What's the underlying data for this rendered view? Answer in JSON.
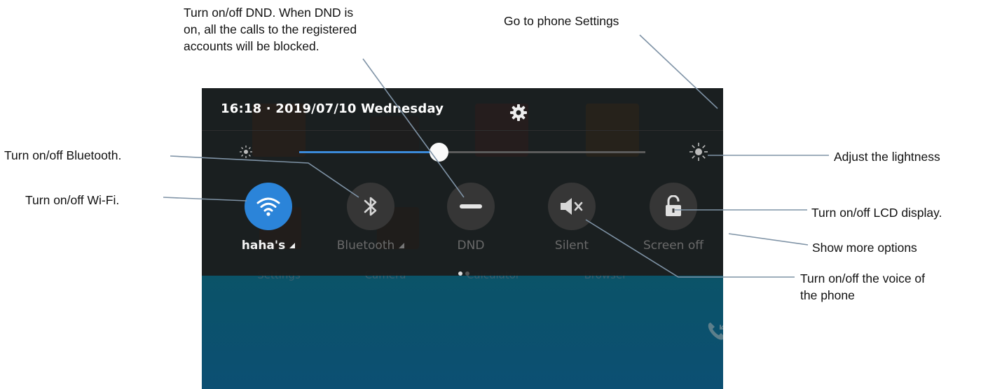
{
  "annotations": {
    "dnd_line1": "Turn on/off DND. When DND is",
    "dnd_line2": "on, all the calls to the registered",
    "dnd_line3": "accounts will be blocked.",
    "settings": "Go to phone Settings",
    "bluetooth": "Turn on/off Bluetooth.",
    "wifi": "Turn on/off Wi-Fi.",
    "brightness": "Adjust the lightness",
    "lcd": "Turn on/off LCD display.",
    "more": "Show more options",
    "voice_line1": "Turn on/off the voice of",
    "voice_line2": "the phone"
  },
  "status_bar": {
    "datetime": "16:18 · 2019/07/10 Wednesday",
    "settings_icon": "gear-icon"
  },
  "brightness_slider": {
    "level_fraction": 0.4,
    "low_icon": "brightness-low-icon",
    "high_icon": "brightness-high-icon",
    "accent": "#3b8ad9"
  },
  "quick_tiles": [
    {
      "label": "haha's",
      "icon": "wifi-icon",
      "active": true,
      "has_menu": true
    },
    {
      "label": "Bluetooth",
      "icon": "bluetooth-icon",
      "active": false,
      "has_menu": true
    },
    {
      "label": "DND",
      "icon": "minus-circle-icon",
      "active": false,
      "has_menu": false
    },
    {
      "label": "Silent",
      "icon": "speaker-mute-icon",
      "active": false,
      "has_menu": false
    },
    {
      "label": "Screen off",
      "icon": "unlock-icon",
      "active": false,
      "has_menu": false
    }
  ],
  "page_indicator": {
    "pages": 2,
    "current": 1
  },
  "background_dock": [
    "Settings",
    "Camera",
    "Calculator",
    "Browser"
  ],
  "colors": {
    "active_tile": "#2b84d9",
    "shade": "#1c1c1c",
    "wallpaper": "#0a5563"
  }
}
